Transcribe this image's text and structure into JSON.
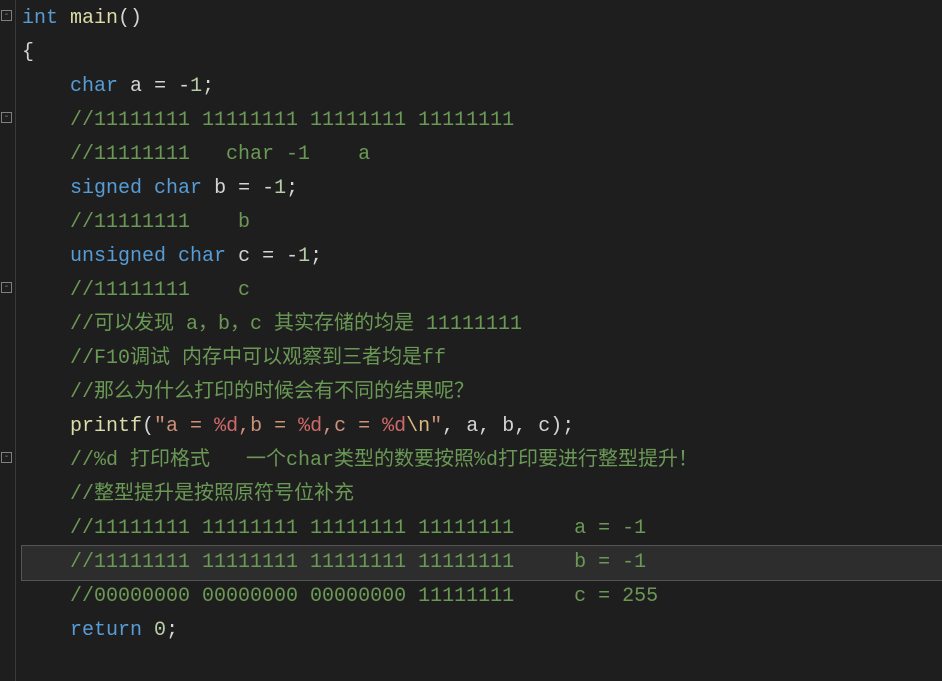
{
  "editor": {
    "fold_markers": [
      {
        "row": 0,
        "glyph": "-"
      },
      {
        "row": 3,
        "glyph": "-"
      },
      {
        "row": 8,
        "glyph": "-"
      },
      {
        "row": 13,
        "glyph": "-"
      }
    ],
    "highlight_row": 16,
    "lines": [
      {
        "indent": 0,
        "tokens": [
          {
            "cls": "tok-type",
            "t": "int"
          },
          {
            "cls": "tok-punct",
            "t": " "
          },
          {
            "cls": "tok-func",
            "t": "main"
          },
          {
            "cls": "tok-paren",
            "t": "()"
          }
        ]
      },
      {
        "indent": 0,
        "tokens": [
          {
            "cls": "tok-punct",
            "t": "{"
          }
        ]
      },
      {
        "indent": 1,
        "tokens": [
          {
            "cls": "tok-type",
            "t": "char"
          },
          {
            "cls": "tok-punct",
            "t": " "
          },
          {
            "cls": "tok-ident-w",
            "t": "a"
          },
          {
            "cls": "tok-punct",
            "t": " = "
          },
          {
            "cls": "tok-punct",
            "t": "-"
          },
          {
            "cls": "tok-num",
            "t": "1"
          },
          {
            "cls": "tok-punct",
            "t": ";"
          }
        ]
      },
      {
        "indent": 1,
        "tokens": [
          {
            "cls": "tok-comment",
            "t": "//11111111 11111111 11111111 11111111"
          }
        ]
      },
      {
        "indent": 1,
        "tokens": [
          {
            "cls": "tok-comment",
            "t": "//11111111   char -1    a"
          }
        ]
      },
      {
        "indent": 1,
        "tokens": [
          {
            "cls": "tok-type",
            "t": "signed"
          },
          {
            "cls": "tok-punct",
            "t": " "
          },
          {
            "cls": "tok-type",
            "t": "char"
          },
          {
            "cls": "tok-punct",
            "t": " "
          },
          {
            "cls": "tok-ident-w",
            "t": "b"
          },
          {
            "cls": "tok-punct",
            "t": " = "
          },
          {
            "cls": "tok-punct",
            "t": "-"
          },
          {
            "cls": "tok-num",
            "t": "1"
          },
          {
            "cls": "tok-punct",
            "t": ";"
          }
        ]
      },
      {
        "indent": 1,
        "tokens": [
          {
            "cls": "tok-comment",
            "t": "//11111111    b"
          }
        ]
      },
      {
        "indent": 1,
        "tokens": [
          {
            "cls": "tok-type",
            "t": "unsigned"
          },
          {
            "cls": "tok-punct",
            "t": " "
          },
          {
            "cls": "tok-type",
            "t": "char"
          },
          {
            "cls": "tok-punct",
            "t": " "
          },
          {
            "cls": "tok-ident-w",
            "t": "c"
          },
          {
            "cls": "tok-punct",
            "t": " = "
          },
          {
            "cls": "tok-punct",
            "t": "-"
          },
          {
            "cls": "tok-num",
            "t": "1"
          },
          {
            "cls": "tok-punct",
            "t": ";"
          }
        ]
      },
      {
        "indent": 1,
        "tokens": [
          {
            "cls": "tok-comment",
            "t": "//11111111    c"
          }
        ]
      },
      {
        "indent": 1,
        "tokens": [
          {
            "cls": "tok-comment",
            "t": "//可以发现 a，b，c 其实存储的均是 11111111"
          }
        ]
      },
      {
        "indent": 1,
        "tokens": [
          {
            "cls": "tok-comment",
            "t": "//F10调试 内存中可以观察到三者均是ff"
          }
        ]
      },
      {
        "indent": 1,
        "tokens": [
          {
            "cls": "tok-comment",
            "t": "//那么为什么打印的时候会有不同的结果呢？"
          }
        ]
      },
      {
        "indent": 1,
        "tokens": [
          {
            "cls": "tok-func",
            "t": "printf"
          },
          {
            "cls": "tok-paren",
            "t": "("
          },
          {
            "cls": "tok-str",
            "t": "\"a = "
          },
          {
            "cls": "tok-fmt",
            "t": "%d"
          },
          {
            "cls": "tok-str",
            "t": ",b = "
          },
          {
            "cls": "tok-fmt",
            "t": "%d"
          },
          {
            "cls": "tok-str",
            "t": ",c = "
          },
          {
            "cls": "tok-fmt",
            "t": "%d"
          },
          {
            "cls": "tok-esc",
            "t": "\\n"
          },
          {
            "cls": "tok-str",
            "t": "\""
          },
          {
            "cls": "tok-punct",
            "t": ", "
          },
          {
            "cls": "tok-ident-w",
            "t": "a"
          },
          {
            "cls": "tok-punct",
            "t": ", "
          },
          {
            "cls": "tok-ident-w",
            "t": "b"
          },
          {
            "cls": "tok-punct",
            "t": ", "
          },
          {
            "cls": "tok-ident-w",
            "t": "c"
          },
          {
            "cls": "tok-paren",
            "t": ")"
          },
          {
            "cls": "tok-punct",
            "t": ";"
          }
        ]
      },
      {
        "indent": 1,
        "tokens": [
          {
            "cls": "tok-comment",
            "t": "//%d 打印格式   一个char类型的数要按照%d打印要进行整型提升！"
          }
        ]
      },
      {
        "indent": 1,
        "tokens": [
          {
            "cls": "tok-comment",
            "t": "//整型提升是按照原符号位补充"
          }
        ]
      },
      {
        "indent": 1,
        "tokens": [
          {
            "cls": "tok-comment",
            "t": "//11111111 11111111 11111111 11111111     a = -1"
          }
        ]
      },
      {
        "indent": 1,
        "tokens": [
          {
            "cls": "tok-comment",
            "t": "//11111111 11111111 11111111 11111111     b = -1"
          }
        ]
      },
      {
        "indent": 1,
        "tokens": [
          {
            "cls": "tok-comment",
            "t": "//00000000 00000000 00000000 11111111     c = 255"
          }
        ]
      },
      {
        "indent": 1,
        "tokens": [
          {
            "cls": "tok-kw",
            "t": "return"
          },
          {
            "cls": "tok-punct",
            "t": " "
          },
          {
            "cls": "tok-num",
            "t": "0"
          },
          {
            "cls": "tok-punct",
            "t": ";"
          }
        ]
      }
    ]
  }
}
